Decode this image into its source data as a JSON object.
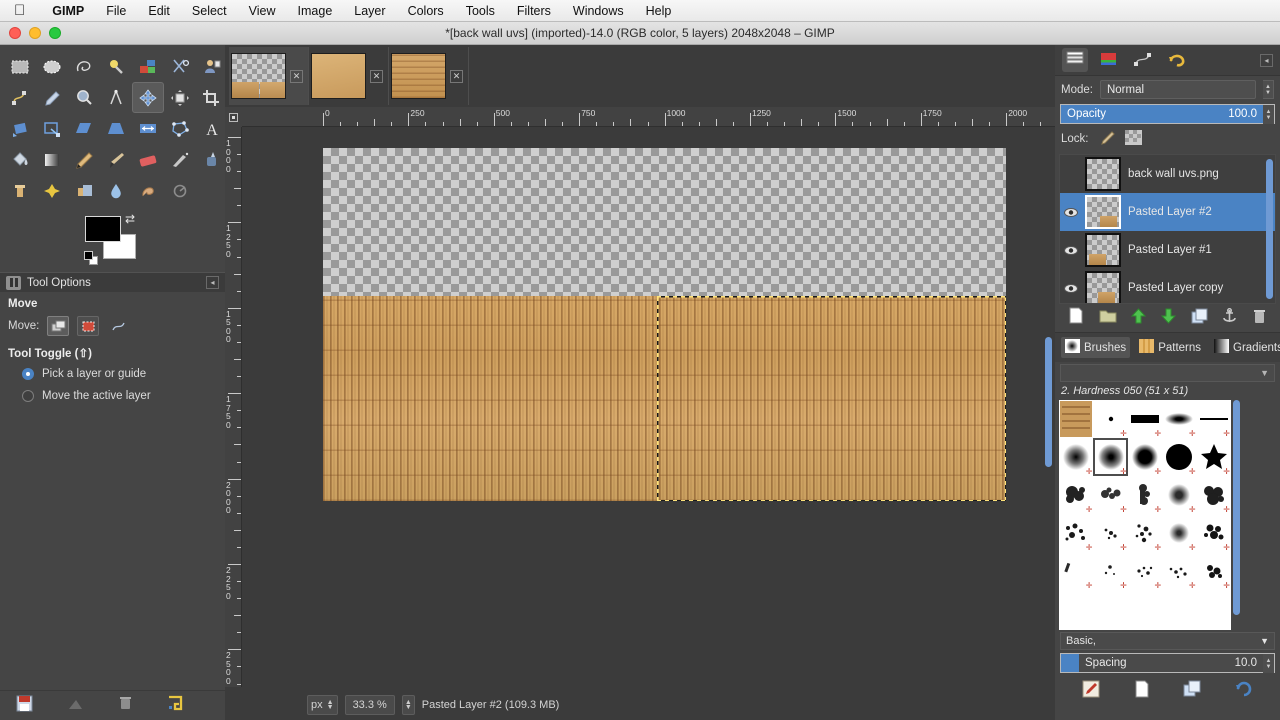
{
  "menubar": {
    "apple_icon": "apple-logo-icon",
    "items": [
      "GIMP",
      "File",
      "Edit",
      "Select",
      "View",
      "Image",
      "Layer",
      "Colors",
      "Tools",
      "Filters",
      "Windows",
      "Help"
    ]
  },
  "titlebar": {
    "title": "*[back wall uvs] (imported)-14.0 (RGB color, 5 layers) 2048x2048 – GIMP"
  },
  "toolbox": {
    "tools": [
      {
        "name": "rect-select-tool",
        "row": 1
      },
      {
        "name": "ellipse-select-tool",
        "row": 1
      },
      {
        "name": "free-select-tool",
        "row": 1
      },
      {
        "name": "fuzzy-select-tool",
        "row": 1
      },
      {
        "name": "select-by-color-tool",
        "row": 1
      },
      {
        "name": "scissors-select-tool",
        "row": 1
      },
      {
        "name": "foreground-select-tool",
        "row": 1
      },
      {
        "name": "paths-tool",
        "row": 2
      },
      {
        "name": "color-picker-tool",
        "row": 2
      },
      {
        "name": "zoom-tool",
        "row": 2
      },
      {
        "name": "measure-tool",
        "row": 2
      },
      {
        "name": "move-tool",
        "row": 2
      },
      {
        "name": "alignment-tool",
        "row": 2
      },
      {
        "name": "crop-tool",
        "row": 2
      },
      {
        "name": "rotate-tool",
        "row": 3
      },
      {
        "name": "scale-tool",
        "row": 3
      },
      {
        "name": "shear-tool",
        "row": 3
      },
      {
        "name": "perspective-tool",
        "row": 3
      },
      {
        "name": "flip-tool",
        "row": 3
      },
      {
        "name": "cage-transform-tool",
        "row": 3
      },
      {
        "name": "text-tool",
        "row": 3
      },
      {
        "name": "bucket-fill-tool",
        "row": 4
      },
      {
        "name": "gradient-tool",
        "row": 4
      },
      {
        "name": "pencil-tool",
        "row": 4
      },
      {
        "name": "paintbrush-tool",
        "row": 4
      },
      {
        "name": "eraser-tool",
        "row": 4
      },
      {
        "name": "airbrush-tool",
        "row": 4
      },
      {
        "name": "ink-tool",
        "row": 4
      },
      {
        "name": "clone-tool",
        "row": 5
      },
      {
        "name": "heal-tool",
        "row": 5
      },
      {
        "name": "perspective-clone-tool",
        "row": 5
      },
      {
        "name": "blur-sharpen-tool",
        "row": 5
      },
      {
        "name": "smudge-tool",
        "row": 5
      },
      {
        "name": "dodge-burn-tool",
        "row": 5
      }
    ],
    "active_tool": "move-tool",
    "foreground_color": "#000000",
    "background_color": "#ffffff",
    "bottom_icons": [
      "save-device-status-icon",
      "device-status-icon",
      "trash-icon",
      "reset-icon"
    ]
  },
  "tool_options": {
    "panel_label": "Tool Options",
    "title": "Move",
    "move_label": "Move:",
    "toggle_label": "Tool Toggle",
    "toggle_shortcut": "(⇧)",
    "radio_options": [
      {
        "label": "Pick a layer or guide",
        "selected": true
      },
      {
        "label": "Move the active layer",
        "selected": false
      }
    ]
  },
  "image_tabs": [
    {
      "name": "tab-back-wall-uvs",
      "active": true,
      "close_label": "✕"
    },
    {
      "name": "tab-wood-texture-1",
      "active": false,
      "close_label": "✕"
    },
    {
      "name": "tab-hieroglyph-texture",
      "active": false,
      "close_label": "✕"
    }
  ],
  "canvas": {
    "h_ruler_labels": [
      "0",
      "250",
      "500",
      "750",
      "1000",
      "1250",
      "1500",
      "1750",
      "2000"
    ],
    "v_ruler_labels": [
      "1000",
      "1250",
      "1500",
      "1750",
      "2000",
      "2250",
      "2500"
    ],
    "selection_active": true
  },
  "statusbar": {
    "unit": "px",
    "zoom": "33.3 %",
    "layer_info": "Pasted Layer #2 (109.3 MB)"
  },
  "layers_dock": {
    "tabs": [
      "layers-icon",
      "channels-icon",
      "paths-icon",
      "undo-history-icon"
    ],
    "active_tab": "layers-icon",
    "mode_label": "Mode:",
    "mode_value": "Normal",
    "opacity_label": "Opacity",
    "opacity_value": "100.0",
    "lock_label": "Lock:",
    "lock_icons": [
      "lock-pixels-icon",
      "lock-alpha-icon"
    ],
    "layers": [
      {
        "name": "back wall uvs.png",
        "visible": false,
        "selected": false,
        "has_fragment": false
      },
      {
        "name": "Pasted Layer #2",
        "visible": true,
        "selected": true,
        "has_fragment": true
      },
      {
        "name": "Pasted Layer #1",
        "visible": true,
        "selected": false,
        "has_fragment": true
      },
      {
        "name": "Pasted Layer copy",
        "visible": true,
        "selected": false,
        "has_fragment": true
      }
    ],
    "buttons": [
      "new-layer-icon",
      "new-group-icon",
      "raise-layer-icon",
      "lower-layer-icon",
      "duplicate-layer-icon",
      "anchor-layer-icon",
      "delete-layer-icon"
    ]
  },
  "brushes_dock": {
    "tabs": [
      {
        "label": "Brushes",
        "icon": "brushes-icon",
        "active": true
      },
      {
        "label": "Patterns",
        "icon": "patterns-icon",
        "active": false
      },
      {
        "label": "Gradients",
        "icon": "gradients-icon",
        "active": false
      }
    ],
    "filter_placeholder": "",
    "selected_brush": "2. Hardness 050 (51 x 51)",
    "brush_grid": [
      [
        "texture-swatch",
        "dot-tiny",
        "bar-hard",
        "ellipse-soft",
        "line-thin"
      ],
      [
        "hardness-025",
        "hardness-050",
        "hardness-075",
        "hardness-100",
        "star"
      ],
      [
        "acrylic-01",
        "acrylic-02",
        "acrylic-03",
        "acrylic-04",
        "acrylic-05"
      ],
      [
        "splatter-01",
        "splatter-02",
        "splatter-03",
        "splatter-04",
        "splatter-05"
      ],
      [
        "grunge-01",
        "grunge-02",
        "grunge-03",
        "grunge-04",
        "grunge-05"
      ],
      [
        "chalk-01",
        "chalk-02",
        "chalk-03",
        "chalk-04",
        "chalk-05"
      ]
    ],
    "tag_value": "Basic,",
    "spacing_label": "Spacing",
    "spacing_value": "10.0",
    "buttons": [
      "edit-brush-icon",
      "new-brush-icon",
      "duplicate-brush-icon",
      "refresh-brushes-icon"
    ]
  },
  "colors": {
    "accent_blue": "#4a83c4",
    "panel_bg": "#454545",
    "canvas_bg": "#3b3b3b",
    "selection_gold": "#ffe47a"
  }
}
